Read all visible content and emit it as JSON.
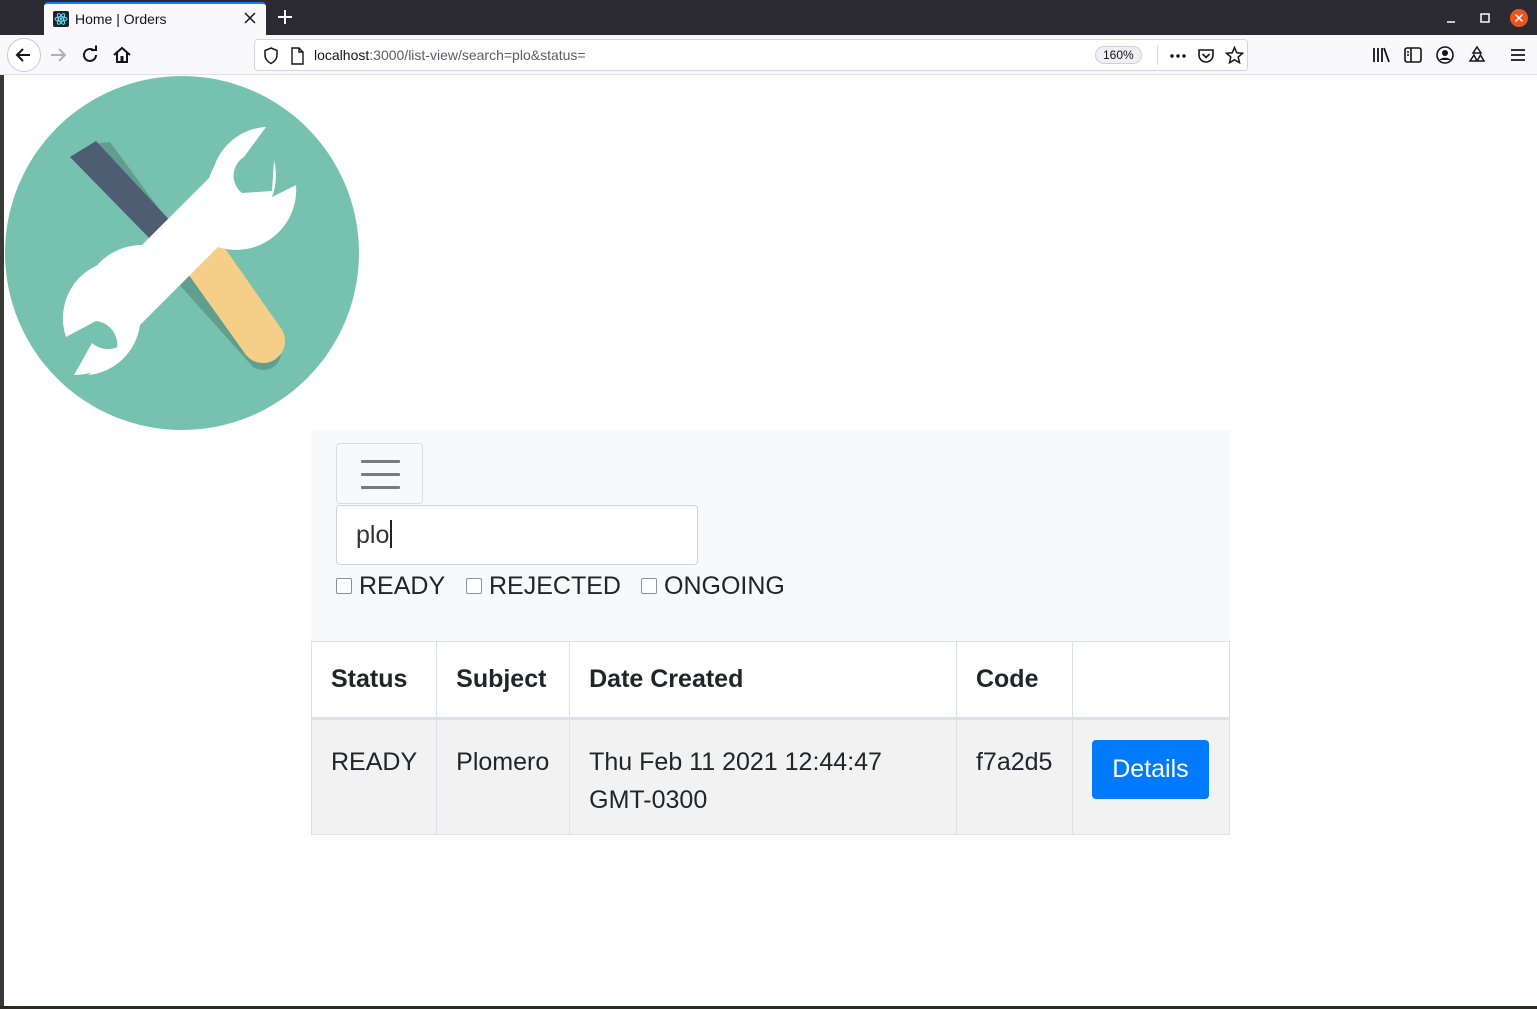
{
  "browser": {
    "tab_title": "Home | Orders",
    "url_host": "localhost",
    "url_rest": ":3000/list-view/search=plo&status=",
    "zoom": "160%"
  },
  "icons": {
    "favicon": "react-atom-icon",
    "back": "back-arrow-icon",
    "forward": "forward-arrow-icon",
    "reload": "reload-icon",
    "home": "home-icon",
    "shield": "shield-icon",
    "page": "page-icon",
    "more": "more-dots-icon",
    "pocket": "pocket-icon",
    "star": "star-icon",
    "library": "library-icon",
    "sidebar": "sidebar-icon",
    "account": "account-icon",
    "extension": "recycle-icon",
    "menu": "menu-icon",
    "logo": "wrench-screwdriver-logo"
  },
  "colors": {
    "logo_bg": "#76c2af",
    "screwdriver_blade": "#4f5d73",
    "screwdriver_handle": "#f5cf87",
    "wrench": "#ffffff",
    "primary_button": "#007bff"
  },
  "search": {
    "value": "plo"
  },
  "filters": [
    {
      "label": "READY",
      "checked": false
    },
    {
      "label": "REJECTED",
      "checked": false
    },
    {
      "label": "ONGOING",
      "checked": false
    }
  ],
  "table": {
    "headers": [
      "Status",
      "Subject",
      "Date Created",
      "Code",
      ""
    ],
    "rows": [
      {
        "status": "READY",
        "subject": "Plomero",
        "date_line1": "Thu Feb 11 2021 12:44:47",
        "date_line2": "GMT-0300",
        "code": "f7a2d5",
        "action_label": "Details"
      }
    ]
  }
}
